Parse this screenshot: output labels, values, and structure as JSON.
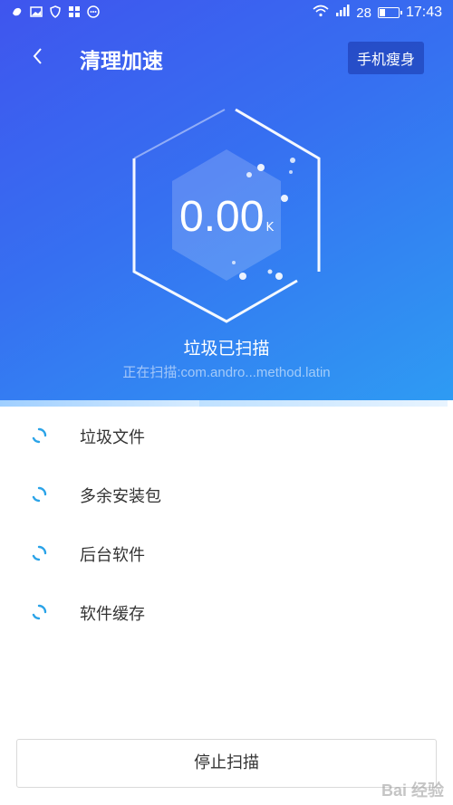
{
  "status_bar": {
    "icons": [
      "notification-icon",
      "gallery-icon",
      "shield-icon",
      "app-icon",
      "more-icon"
    ],
    "signal_label": "28",
    "time": "17:43"
  },
  "header": {
    "title": "清理加速",
    "slim_button": "手机瘦身"
  },
  "scan": {
    "size_value": "0.00",
    "size_unit": "K",
    "status": "垃圾已扫描",
    "current": "正在扫描:com.andro...method.latin",
    "progress": 0.44
  },
  "items": [
    {
      "label": "垃圾文件"
    },
    {
      "label": "多余安装包"
    },
    {
      "label": "后台软件"
    },
    {
      "label": "软件缓存"
    }
  ],
  "stop_button": "停止扫描",
  "watermark": "Bai 经验",
  "colors": {
    "gradient_start": "#3f55ee",
    "gradient_end": "#2e9cf3",
    "spinner": "#2aa3e8"
  }
}
